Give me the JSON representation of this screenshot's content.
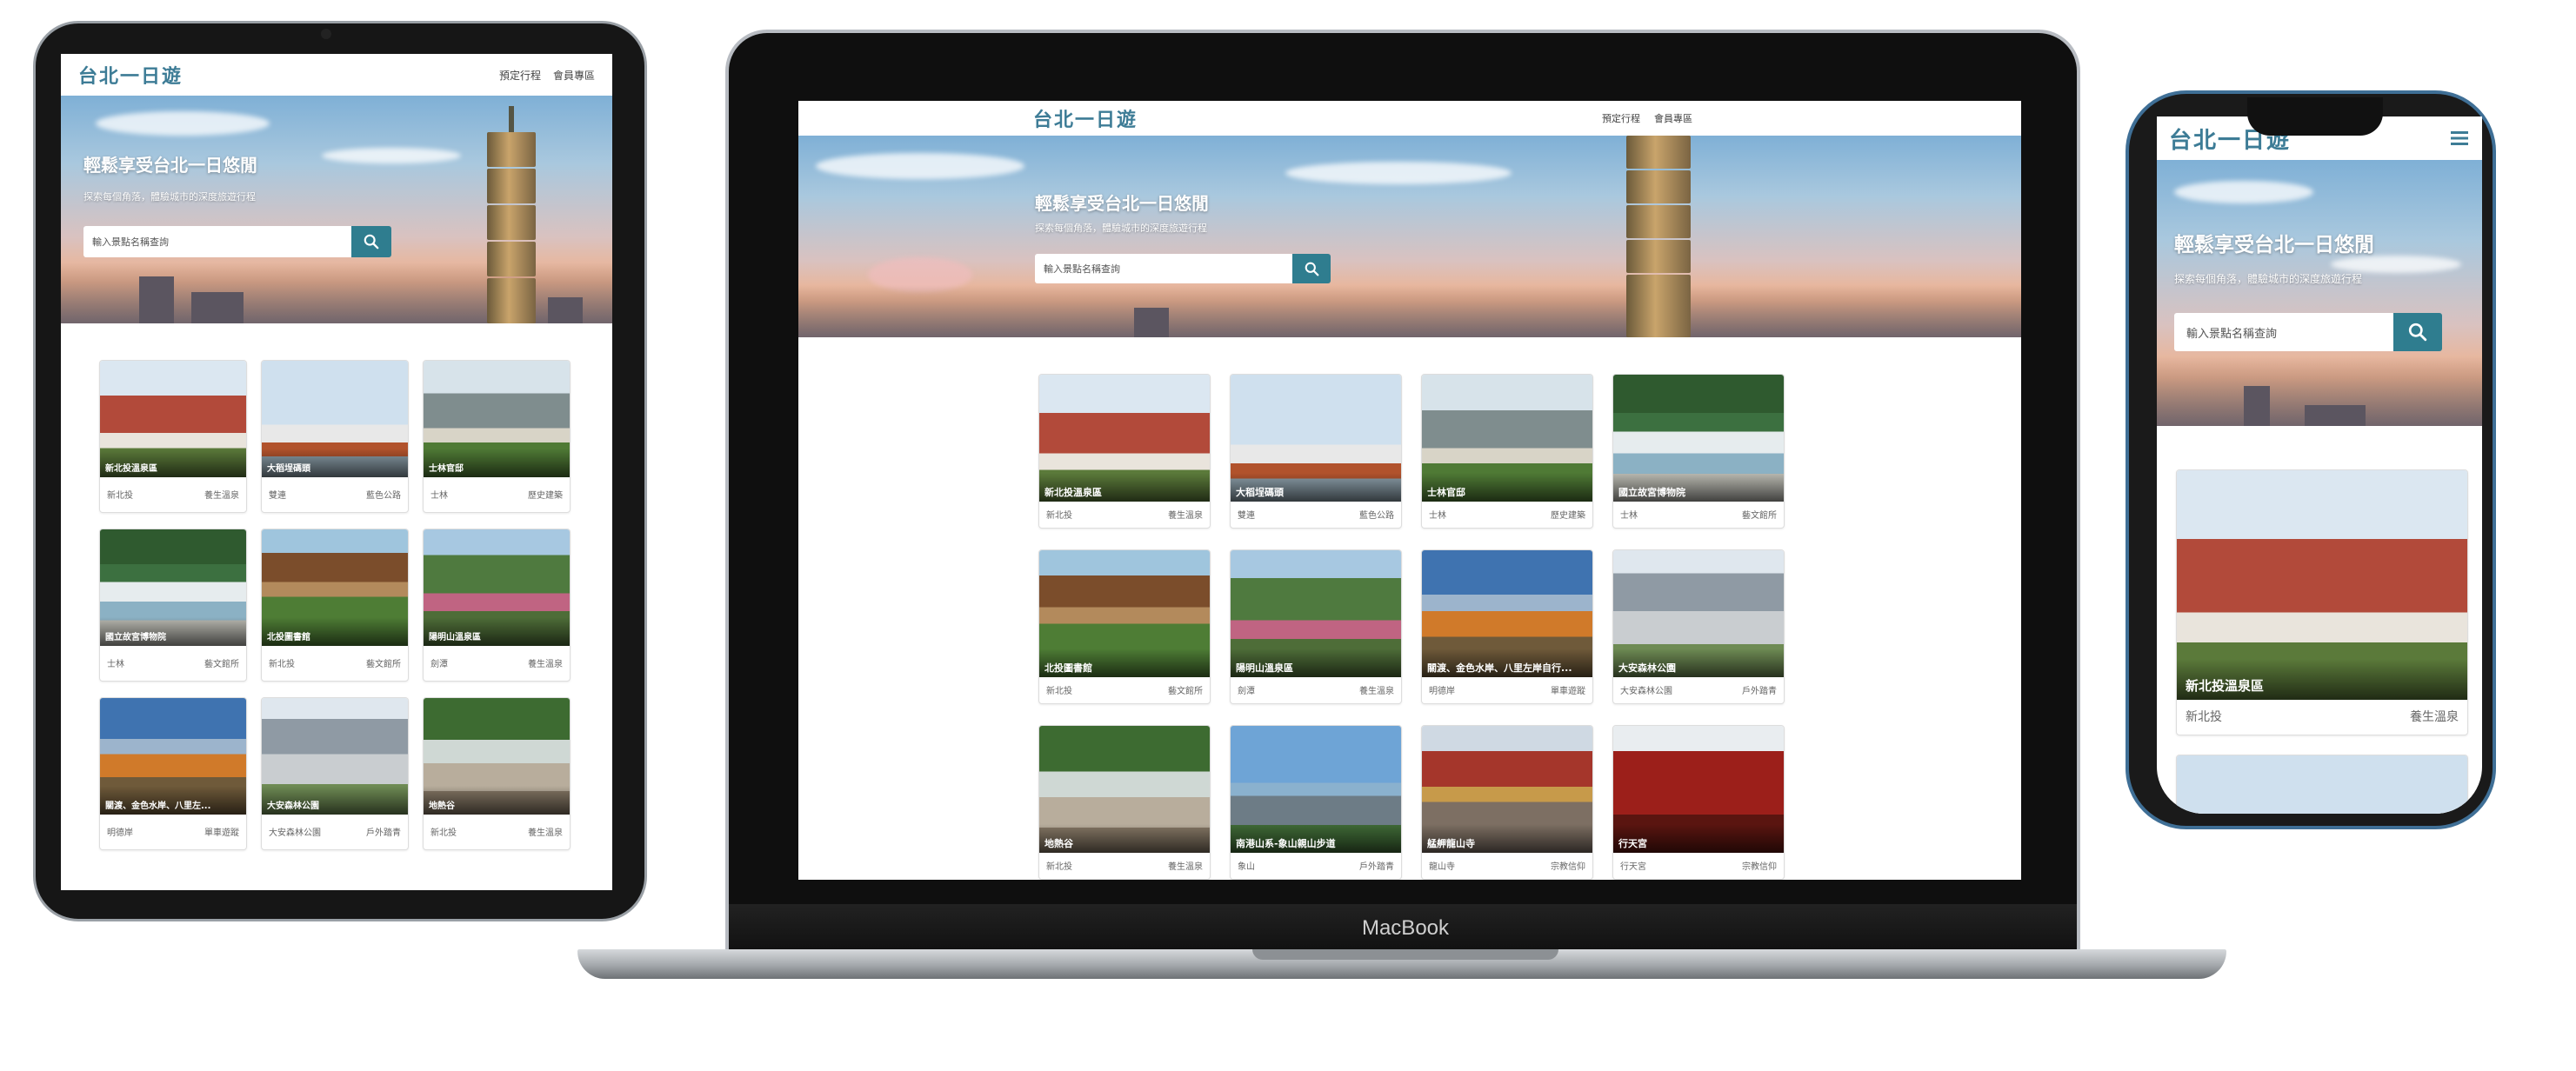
{
  "site": {
    "logo": "台北一日遊",
    "nav": [
      "預定行程",
      "會員專區"
    ],
    "hero_title": "輕鬆享受台北一日悠閒",
    "hero_sub": "探索每個角落，體驗城市的深度旅遊行程",
    "search_placeholder": "輸入景點名稱查詢"
  },
  "laptop_label": "MacBook",
  "attractions": [
    {
      "name": "新北投溫泉區",
      "mrt": "新北投",
      "category": "養生溫泉"
    },
    {
      "name": "大稻埕碼頭",
      "mrt": "雙連",
      "category": "藍色公路"
    },
    {
      "name": "士林官邸",
      "mrt": "士林",
      "category": "歷史建築"
    },
    {
      "name": "國立故宮博物院",
      "mrt": "士林",
      "category": "藝文館所"
    },
    {
      "name": "北投圖書館",
      "mrt": "新北投",
      "category": "藝文館所"
    },
    {
      "name": "陽明山溫泉區",
      "mrt": "劍潭",
      "category": "養生溫泉"
    },
    {
      "name": "關渡、金色水岸、八里左岸自行...",
      "mrt": "明德岸",
      "category": "單車遊蹤"
    },
    {
      "name": "大安森林公園",
      "mrt": "大安森林公園",
      "category": "戶外踏青"
    },
    {
      "name": "地熱谷",
      "mrt": "新北投",
      "category": "養生溫泉"
    },
    {
      "name": "南港山系-象山親山步道",
      "mrt": "象山",
      "category": "戶外踏青"
    },
    {
      "name": "艋舺龍山寺",
      "mrt": "龍山寺",
      "category": "宗教信仰"
    },
    {
      "name": "行天宮",
      "mrt": "行天宮",
      "category": "宗教信仰"
    }
  ],
  "tablet_captions": [
    "新北投溫泉區",
    "大稻埕碼頭",
    "士林官邸",
    "國立故宮博物院",
    "北投圖書館",
    "陽明山溫泉區",
    "關渡、金色水岸、八里左...",
    "大安森林公園",
    "地熱谷"
  ]
}
